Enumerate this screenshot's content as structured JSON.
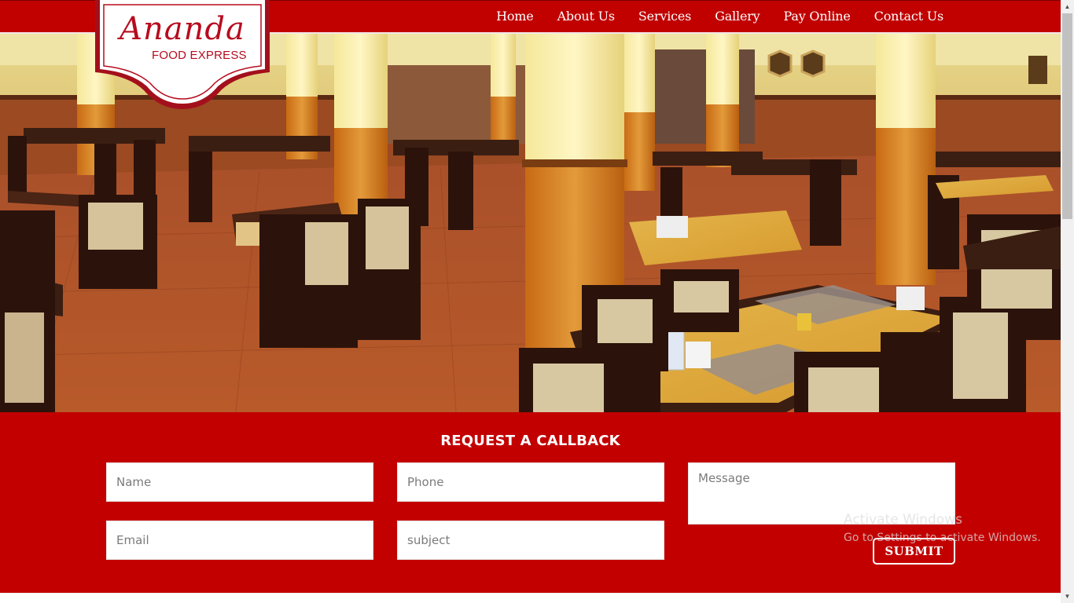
{
  "brand": {
    "name": "Ananda",
    "subtitle": "FOOD EXPRESS"
  },
  "nav": {
    "items": [
      {
        "label": "Home"
      },
      {
        "label": "About Us"
      },
      {
        "label": "Services"
      },
      {
        "label": "Gallery"
      },
      {
        "label": "Pay Online"
      },
      {
        "label": "Contact Us"
      }
    ]
  },
  "callback": {
    "title": "REQUEST A CALLBACK",
    "name_placeholder": "Name",
    "phone_placeholder": "Phone",
    "message_placeholder": "Message",
    "email_placeholder": "Email",
    "subject_placeholder": "subject",
    "submit_label": "SUBMIT"
  },
  "watermark": {
    "line1": "Activate Windows",
    "line2": "Go to Settings to activate Windows."
  },
  "colors": {
    "brand_red": "#c10000",
    "logo_red": "#b70b1e"
  },
  "icons": {
    "scroll_up": "▲",
    "scroll_down": "▼"
  }
}
